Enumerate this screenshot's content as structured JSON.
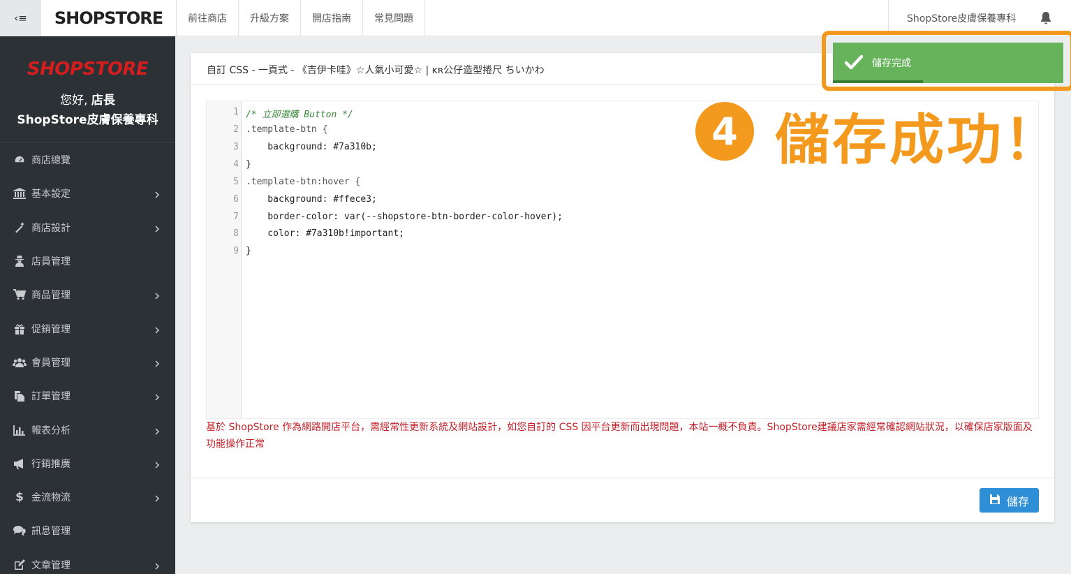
{
  "topbar": {
    "toggle_label": "‹≡",
    "logo": "SHOPSTORE",
    "nav": [
      "前往商店",
      "升級方案",
      "開店指南",
      "常見問題"
    ],
    "store_name": "ShopStore皮膚保養專科"
  },
  "sidebar": {
    "logo": "SHOPSTORE",
    "greeting": "您好,",
    "role": "店長",
    "store_name": "ShopStore皮膚保養專科",
    "items": [
      {
        "label": "商店總覽",
        "icon": "dashboard-icon",
        "has_submenu": false
      },
      {
        "label": "基本設定",
        "icon": "bank-icon",
        "has_submenu": true
      },
      {
        "label": "商店設計",
        "icon": "magic-wand-icon",
        "has_submenu": true
      },
      {
        "label": "店員管理",
        "icon": "user-secret-icon",
        "has_submenu": false
      },
      {
        "label": "商品管理",
        "icon": "cart-icon",
        "has_submenu": true
      },
      {
        "label": "促銷管理",
        "icon": "gift-icon",
        "has_submenu": true
      },
      {
        "label": "會員管理",
        "icon": "users-icon",
        "has_submenu": true
      },
      {
        "label": "訂單管理",
        "icon": "copy-icon",
        "has_submenu": true
      },
      {
        "label": "報表分析",
        "icon": "bar-chart-icon",
        "has_submenu": true
      },
      {
        "label": "行銷推廣",
        "icon": "bullhorn-icon",
        "has_submenu": true
      },
      {
        "label": "金流物流",
        "icon": "dollar-icon",
        "has_submenu": true
      },
      {
        "label": "訊息管理",
        "icon": "comments-icon",
        "has_submenu": false
      },
      {
        "label": "文章管理",
        "icon": "edit-icon",
        "has_submenu": true
      }
    ]
  },
  "card": {
    "title": "自訂 CSS - 一頁式 - 《吉伊卡哇》☆人氣小可愛☆ | ᴋʀ公仔造型捲尺 ちいかわ",
    "line_numbers": [
      "1",
      "2",
      "3",
      "4",
      "5",
      "6",
      "7",
      "8",
      "9"
    ],
    "code": [
      "/* 立即選購 Button */",
      ".template-btn {",
      "    background: #7a310b;",
      "}",
      ".template-btn:hover {",
      "    background: #ffece3;",
      "    border-color: var(--shopstore-btn-border-color-hover);",
      "    color: #7a310b!important;",
      "}"
    ],
    "warning": "基於 ShopStore 作為網路開店平台，需經常性更新系統及網站設計，如您自訂的 CSS 因平台更新而出現問題，本站一概不負責。ShopStore建議店家需經常確認網站狀況，以確保店家版面及功能操作正常",
    "save_label": "儲存"
  },
  "toast": {
    "message": "儲存完成",
    "progress": 0.39
  },
  "annotation": {
    "step": "4",
    "text": "儲存成功！"
  },
  "colors": {
    "sidebar_bg": "#2c3136",
    "brand_red": "#d21e1e",
    "toast_green": "#67b35c",
    "annotation_orange": "#f39a1e",
    "save_blue": "#2f8fd6",
    "warning_red": "#c4222a"
  }
}
